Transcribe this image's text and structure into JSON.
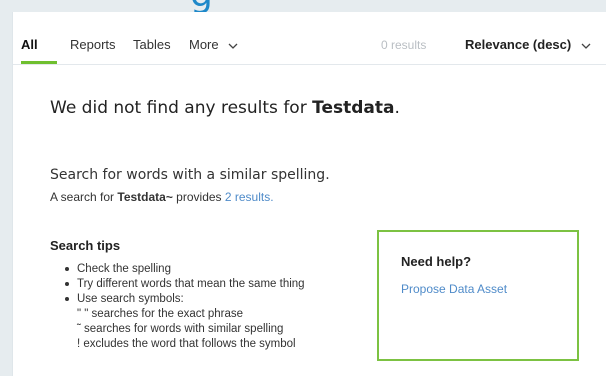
{
  "tabs": [
    {
      "label": "All",
      "active": true
    },
    {
      "label": "Reports",
      "active": false
    },
    {
      "label": "Tables",
      "active": false
    },
    {
      "label": "More",
      "active": false
    }
  ],
  "results_count": "0 results",
  "sort_label": "Relevance (desc)",
  "no_results": {
    "prefix": "We did not find any results for ",
    "query": "Testdata",
    "suffix": "."
  },
  "suggestion": {
    "heading": "Search for words with a similar spelling.",
    "prefix": "A search for ",
    "query": "Testdata~",
    "middle": " provides ",
    "link": "2 results."
  },
  "tips": {
    "title": "Search tips",
    "items": [
      "Check the spelling",
      "Try different words that mean the same thing",
      "Use search symbols:"
    ],
    "symbols": [
      "\" \" searches for the exact phrase",
      "˜ searches for words with similar spelling",
      "! excludes the word that follows the symbol"
    ]
  },
  "help": {
    "title": "Need help?",
    "link": "Propose Data Asset"
  },
  "colors": {
    "accent_green": "#6fbf2f",
    "link_blue": "#4f8bc9",
    "heading_blue": "#1e88c9"
  }
}
